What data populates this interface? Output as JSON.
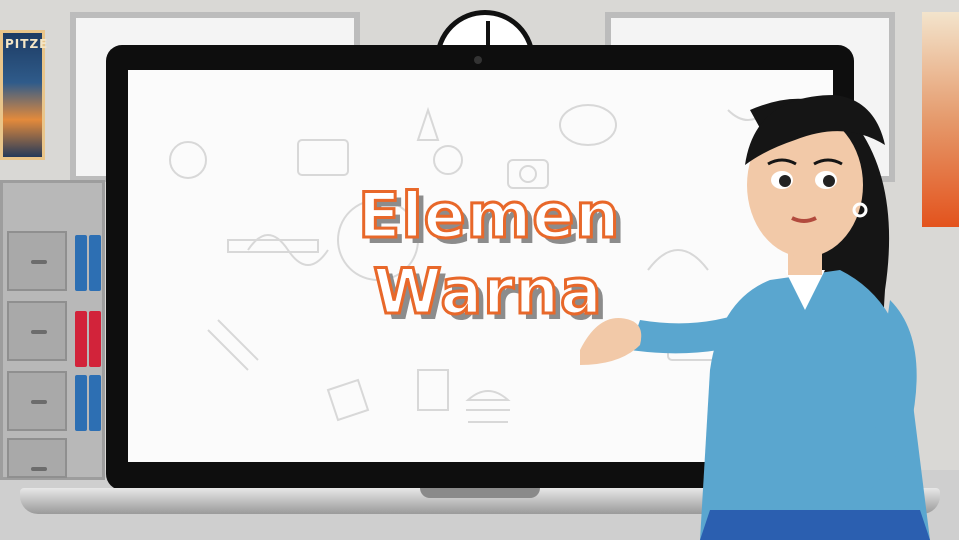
{
  "title": {
    "line1": "Elemen",
    "line2": "Warna"
  },
  "background": {
    "poster_text": "PITZE"
  },
  "colors": {
    "title_outline": "#e8682a",
    "title_fill": "#ffffff",
    "title_shadow": "#8c8c8c",
    "shirt": "#5aa6cf",
    "skirt": "#2b5fb0",
    "hair": "#151515",
    "skin": "#f2c9a8"
  },
  "icons": [
    "clock-icon",
    "doodle-lightbulb-icon",
    "doodle-palette-icon",
    "doodle-camera-icon",
    "doodle-burger-icon",
    "doodle-pencil-icon"
  ]
}
